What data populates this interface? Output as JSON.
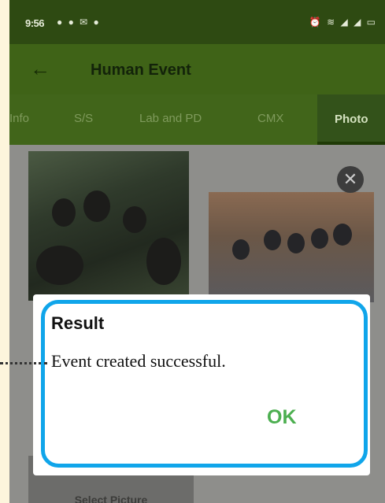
{
  "status_bar": {
    "time": "9:56",
    "left_icons": "● ● ✉ ●",
    "right_icons": "⏰ ≋ ◢ ◢ ▭"
  },
  "app_bar": {
    "title": "Human Event",
    "back_icon": "arrow-left"
  },
  "tabs": [
    {
      "label": "Info",
      "active": false
    },
    {
      "label": "S/S",
      "active": false
    },
    {
      "label": "Lab and PD",
      "active": false
    },
    {
      "label": "CMX",
      "active": false
    },
    {
      "label": "Photo",
      "active": true
    }
  ],
  "select_picture_label": "Select Picture",
  "dialog": {
    "title": "Result",
    "message": "Event created successful.",
    "ok_label": "OK"
  },
  "colors": {
    "highlight": "#10a5ea",
    "ok": "#4caf50",
    "app_bar": "#3f6317"
  }
}
